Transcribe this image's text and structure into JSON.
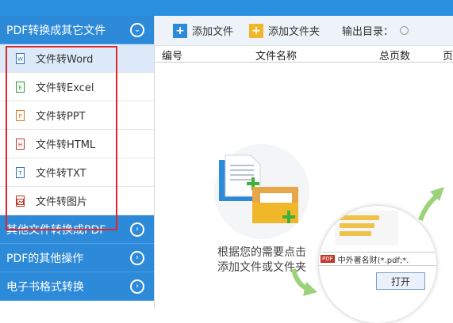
{
  "sidebar": {
    "section1_label": "PDF转换成其它文件",
    "sub_items": [
      {
        "label": "文件转Word",
        "icon": "W"
      },
      {
        "label": "文件转Excel",
        "icon": "E"
      },
      {
        "label": "文件转PPT",
        "icon": "P"
      },
      {
        "label": "文件转HTML",
        "icon": "H"
      },
      {
        "label": "文件转TXT",
        "icon": "T"
      },
      {
        "label": "文件转图片",
        "icon": "img"
      }
    ],
    "section2_label": "其他文件转换成PDF",
    "section3_label": "PDF的其他操作",
    "section4_label": "电子书格式转换"
  },
  "toolbar": {
    "add_file_label": "添加文件",
    "add_folder_label": "添加文件夹",
    "output_dir_label": "输出目录："
  },
  "table": {
    "columns": [
      "编号",
      "文件名称",
      "总页数",
      "页"
    ]
  },
  "hint": {
    "line1": "根据您的需要点击",
    "line2": "添加文件或文件夹"
  },
  "zoom": {
    "filter_text": "中外著名财(*.pdf;*.",
    "open_button": "打开"
  },
  "colors": {
    "accent": "#2d8ad8",
    "highlight_box": "#e0262b",
    "active_item": "#dbe9f8",
    "arrow_green": "#9bd27a"
  }
}
